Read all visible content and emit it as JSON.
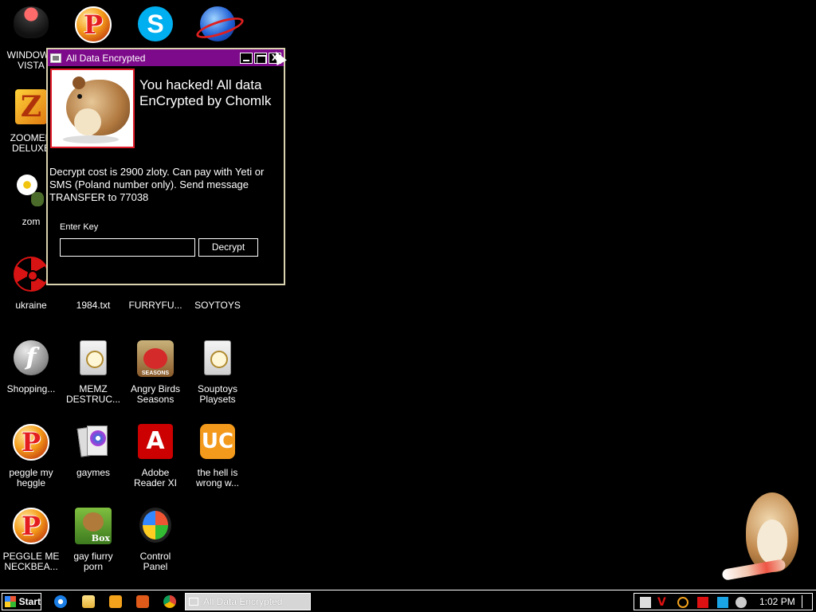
{
  "desktop": {
    "icons": [
      {
        "label": "WINDOWS\nVISTA"
      },
      {
        "label": ""
      },
      {
        "label": ""
      },
      {
        "label": ""
      },
      {
        "label": "ZOOMER\nDELUXE"
      },
      {
        "label": "zom"
      },
      {
        "label": "ukraine"
      },
      {
        "label": "1984.txt"
      },
      {
        "label": "FURRYFU..."
      },
      {
        "label": "SOYTOYS"
      },
      {
        "label": "Shopping..."
      },
      {
        "label": "MEMZ\nDESTRUC..."
      },
      {
        "label": "Angry Birds\nSeasons"
      },
      {
        "label": "Souptoys\nPlaysets"
      },
      {
        "label": "peggle my\nheggle"
      },
      {
        "label": "gaymes"
      },
      {
        "label": "Adobe\nReader XI"
      },
      {
        "label": "the hell is\nwrong w..."
      },
      {
        "label": "PEGGLE ME\nNECKBEA..."
      },
      {
        "label": "gay fiurry\nporn"
      },
      {
        "label": "Control\nPanel"
      }
    ],
    "icon_glyphs": {
      "peggle": "P",
      "skype": "S",
      "zoom": "Z",
      "flash": "f",
      "acrobat": "A",
      "uc": "UC",
      "box": "Box"
    }
  },
  "dialog": {
    "title": "All Data Encrypted",
    "headline": "You hacked! All data EnCrypted by Chomlk",
    "message": "Decrypt cost is 2900 zloty. Can pay with Yeti or SMS (Poland number only). Send message TRANSFER to 77038",
    "key_label": "Enter Key",
    "key_value": "",
    "decrypt_label": "Decrypt",
    "close_glyph": "X",
    "accent": "#7d0a8a"
  },
  "taskbar": {
    "start_label": "Start",
    "task_label": "All Data Encrypted",
    "clock": "1:02 PM",
    "tray_glyph_v": "V"
  }
}
